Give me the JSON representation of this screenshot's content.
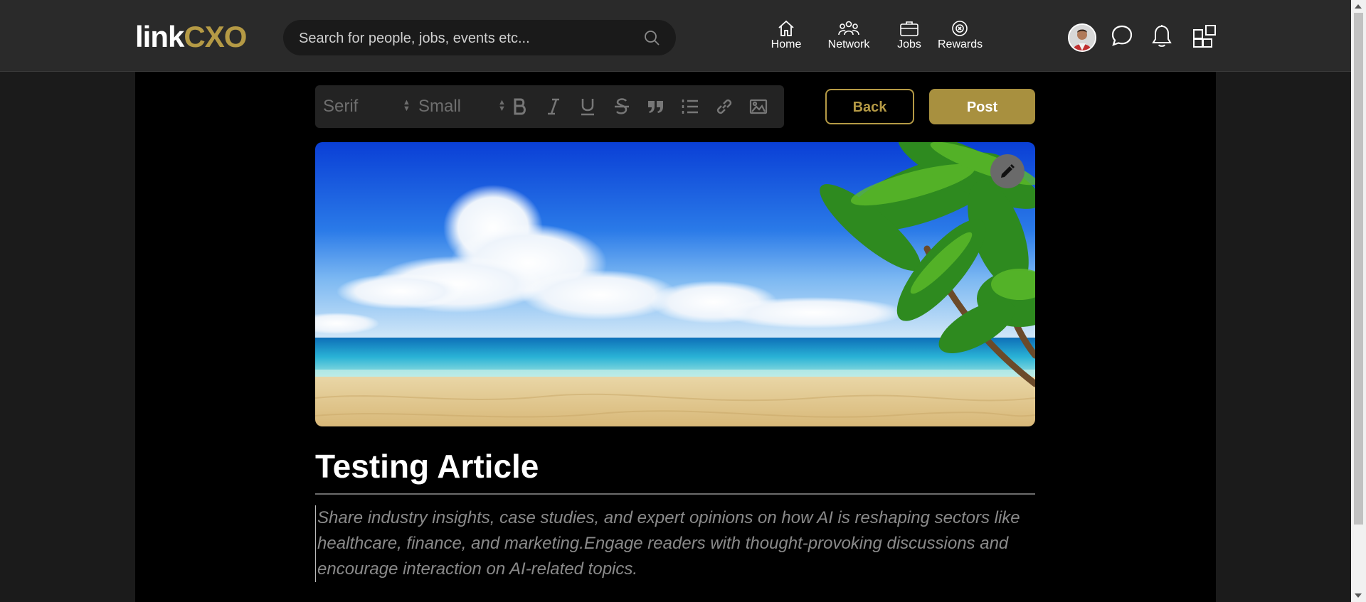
{
  "header": {
    "logo_part1": "link",
    "logo_part2": "CXO",
    "search_placeholder": "Search for people, jobs, events etc...",
    "nav": [
      {
        "label": "Home",
        "icon": "home-icon"
      },
      {
        "label": "Network",
        "icon": "network-icon"
      },
      {
        "label": "Jobs",
        "icon": "jobs-icon"
      },
      {
        "label": "Rewards",
        "icon": "rewards-icon"
      }
    ],
    "right_icons": [
      "avatar",
      "chat-icon",
      "bell-icon",
      "apps-grid-icon"
    ]
  },
  "toolbar": {
    "font_select": "Serif",
    "size_select": "Small",
    "buttons": [
      "bold-icon",
      "italic-icon",
      "underline-icon",
      "strikethrough-icon",
      "quote-icon",
      "ordered-list-icon",
      "link-icon",
      "image-icon"
    ]
  },
  "actions": {
    "back_label": "Back",
    "post_label": "Post"
  },
  "article": {
    "title": "Testing Article",
    "body_placeholder": "Share industry insights, case studies, and expert opinions on how AI is reshaping sectors like healthcare, finance, and marketing.Engage readers with thought-provoking discussions and encourage interaction on AI-related topics."
  },
  "colors": {
    "accent_gold": "#b59a45",
    "post_button": "#a8903f",
    "header_bg": "#2a2a2a",
    "page_bg": "#1b1b1b",
    "content_bg": "#000000"
  }
}
